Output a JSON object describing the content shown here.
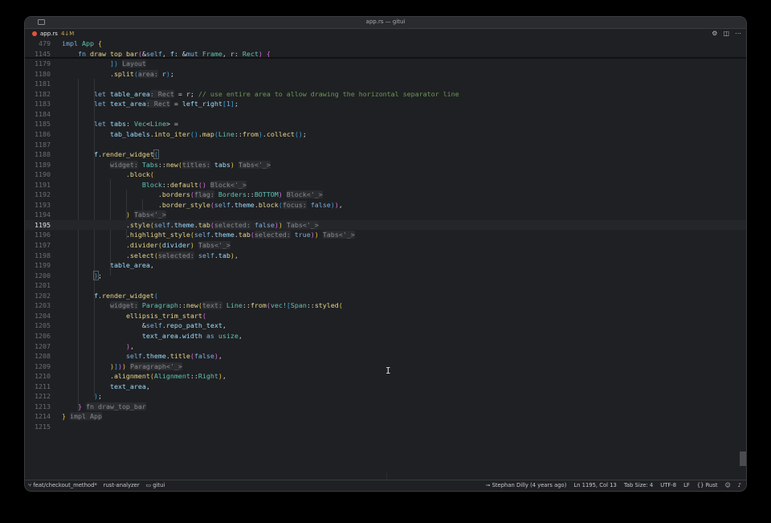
{
  "window_title": "app.rs — gitui",
  "tab": {
    "filename": "app.rs",
    "modified": "4↓M"
  },
  "code_lines": [
    {
      "n": "479",
      "html": "<span class=\"kw\">impl</span> <span class=\"ty\">App</span> <span class=\"br1\">{</span>"
    },
    {
      "n": "1145",
      "html": "    <span class=\"kw\">fn</span> <span class=\"fn\">draw_top_bar</span><span class=\"br2\">(</span>&amp;<span class=\"kw\">self</span>, <span class=\"var\">f</span>: &amp;<span class=\"kw\">mut</span> <span class=\"ty\">Frame</span>, <span class=\"var\">r</span>: <span class=\"ty\">Rect</span><span class=\"br2\">)</span> <span class=\"br2\">{</span>"
    },
    {
      "n": "1179",
      "html": "            <span class=\"br3\">]</span><span class=\"br3\">)</span> <span class=\"hint\">Layout</span>"
    },
    {
      "n": "1180",
      "html": "            .<span class=\"fn\">split</span><span class=\"br3\">(</span><span class=\"hint\">area:</span> <span class=\"var\">r</span><span class=\"br3\">)</span>;"
    },
    {
      "n": "1181",
      "html": ""
    },
    {
      "n": "1182",
      "html": "        <span class=\"kw\">let</span> <span class=\"var\">table_area</span><span class=\"hint\">: Rect</span> = <span class=\"var\">r</span>; <span class=\"cm\">// use entire area to allow drawing the horizontal separator line</span>"
    },
    {
      "n": "1183",
      "html": "        <span class=\"kw\">let</span> <span class=\"var\">text_area</span><span class=\"hint\">: Rect</span> = <span class=\"var\">left_right</span><span class=\"br3\">[</span><span class=\"lit\">1</span><span class=\"br3\">]</span>;"
    },
    {
      "n": "1184",
      "html": ""
    },
    {
      "n": "1185",
      "html": "        <span class=\"kw\">let</span> <span class=\"var\">tabs</span>: <span class=\"ty\">Vec</span>&lt;<span class=\"ty\">Line</span>&gt; ="
    },
    {
      "n": "1186",
      "html": "            <span class=\"var\">tab_labels</span>.<span class=\"fn\">into_iter</span><span class=\"br3\">()</span>.<span class=\"fn\">map</span><span class=\"br3\">(</span><span class=\"ty\">Line</span>::<span class=\"fn\">from</span><span class=\"br3\">)</span>.<span class=\"fn\">collect</span><span class=\"br3\">()</span>;"
    },
    {
      "n": "1187",
      "html": ""
    },
    {
      "n": "1188",
      "html": "        <span class=\"var\">f</span>.<span class=\"fn\">render_widget</span><span class=\"br3 bm\">(</span>"
    },
    {
      "n": "1189",
      "html": "            <span class=\"hint\">widget:</span> <span class=\"ty\">Tabs</span>::<span class=\"fn\">new</span><span class=\"br1\">(</span><span class=\"hint\">titles:</span> <span class=\"var\">tabs</span><span class=\"br1\">)</span> <span class=\"hint\">Tabs&lt;'_&gt;</span>"
    },
    {
      "n": "1190",
      "html": "                .<span class=\"fn\">block</span><span class=\"br1\">(</span>"
    },
    {
      "n": "1191",
      "html": "                    <span class=\"ty\">Block</span>::<span class=\"fn\">default</span><span class=\"br2\">()</span> <span class=\"hint\">Block&lt;'_&gt;</span>"
    },
    {
      "n": "1192",
      "html": "                        .<span class=\"fn\">borders</span><span class=\"br2\">(</span><span class=\"hint\">flag:</span> <span class=\"ty\">Borders</span>::<span class=\"ty\">BOTTOM</span><span class=\"br2\">)</span> <span class=\"hint\">Block&lt;'_&gt;</span>"
    },
    {
      "n": "1193",
      "html": "                        .<span class=\"fn\">border_style</span><span class=\"br2\">(</span><span class=\"kw\">self</span>.<span class=\"var\">theme</span>.<span class=\"fn\">block</span><span class=\"br3\">(</span><span class=\"hint\">focus:</span> <span class=\"lit\">false</span><span class=\"br3\">)</span><span class=\"br2\">)</span>,"
    },
    {
      "n": "1194",
      "html": "                <span class=\"br1\">)</span> <span class=\"hint\">Tabs&lt;'_&gt;</span>"
    },
    {
      "n": "1195",
      "html": "                .<span class=\"fn\">style</span><span class=\"br1\">(</span><span class=\"kw\">self</span>.<span class=\"var\">theme</span>.<span class=\"fn\">tab</span><span class=\"br2\">(</span><span class=\"hint\">selected:</span> <span class=\"lit\">false</span><span class=\"br2\">)</span><span class=\"br1\">)</span> <span class=\"hint\">Tabs&lt;'_&gt;</span>",
      "current": true
    },
    {
      "n": "1196",
      "html": "                .<span class=\"fn\">highlight_style</span><span class=\"br1\">(</span><span class=\"kw\">self</span>.<span class=\"var\">theme</span>.<span class=\"fn\">tab</span><span class=\"br2\">(</span><span class=\"hint\">selected:</span> <span class=\"lit\">true</span><span class=\"br2\">)</span><span class=\"br1\">)</span> <span class=\"hint\">Tabs&lt;'_&gt;</span>"
    },
    {
      "n": "1197",
      "html": "                .<span class=\"fn\">divider</span><span class=\"br1\">(</span><span class=\"var\">divider</span><span class=\"br1\">)</span> <span class=\"hint\">Tabs&lt;'_&gt;</span>"
    },
    {
      "n": "1198",
      "html": "                .<span class=\"fn\">select</span><span class=\"br1\">(</span><span class=\"hint\">selected:</span> <span class=\"kw\">self</span>.<span class=\"var\">tab</span><span class=\"br1\">)</span>,"
    },
    {
      "n": "1199",
      "html": "            <span class=\"var\">table_area</span>,"
    },
    {
      "n": "1200",
      "html": "        <span class=\"br3 bm\">)</span>;"
    },
    {
      "n": "1201",
      "html": ""
    },
    {
      "n": "1202",
      "html": "        <span class=\"var\">f</span>.<span class=\"fn\">render_widget</span><span class=\"br3\">(</span>"
    },
    {
      "n": "1203",
      "html": "            <span class=\"hint\">widget:</span> <span class=\"ty\">Paragraph</span>::<span class=\"fn\">new</span><span class=\"br1\">(</span><span class=\"hint\">text:</span> <span class=\"ty\">Line</span>::<span class=\"fn\">from</span><span class=\"br2\">(</span><span class=\"mac\">vec!</span><span class=\"br3\">[</span><span class=\"ty\">Span</span>::<span class=\"fn\">styled</span><span class=\"br1\">(</span>"
    },
    {
      "n": "1204",
      "html": "                <span class=\"fn\">ellipsis_trim_start</span><span class=\"br2\">(</span>"
    },
    {
      "n": "1205",
      "html": "                    &amp;<span class=\"kw\">self</span>.<span class=\"var\">repo_path_text</span>,"
    },
    {
      "n": "1206",
      "html": "                    <span class=\"var\">text_area</span>.<span class=\"var\">width</span> <span class=\"kw\">as</span> <span class=\"ty\">usize</span>,"
    },
    {
      "n": "1207",
      "html": "                <span class=\"br2\">)</span>,"
    },
    {
      "n": "1208",
      "html": "                <span class=\"kw\">self</span>.<span class=\"var\">theme</span>.<span class=\"fn\">title</span><span class=\"br2\">(</span><span class=\"lit\">false</span><span class=\"br2\">)</span>,"
    },
    {
      "n": "1209",
      "html": "            <span class=\"br1\">)</span><span class=\"br3\">]</span><span class=\"br2\">)</span><span class=\"br1\">)</span> <span class=\"hint\">Paragraph&lt;'_&gt;</span>"
    },
    {
      "n": "1210",
      "html": "            .<span class=\"fn\">alignment</span><span class=\"br1\">(</span><span class=\"ty\">Alignment</span>::<span class=\"ty\">Right</span><span class=\"br1\">)</span>,"
    },
    {
      "n": "1211",
      "html": "            <span class=\"var\">text_area</span>,"
    },
    {
      "n": "1212",
      "html": "        <span class=\"br3\">)</span>;"
    },
    {
      "n": "1213",
      "html": "    <span class=\"br2\">}</span> <span class=\"hint\">fn draw_top_bar</span>"
    },
    {
      "n": "1214",
      "html": "<span class=\"br1\">}</span> <span class=\"hint\">impl App</span>"
    },
    {
      "n": "1215",
      "html": ""
    }
  ],
  "status": {
    "branch": "feat/checkout_method*",
    "language_server": "rust-analyzer",
    "folder": "gitui",
    "blame": "Stephan Dilly (4 years ago)",
    "position": "Ln 1195, Col 13",
    "tab_size": "Tab Size: 4",
    "encoding": "UTF-8",
    "eol": "LF",
    "language": "Rust"
  },
  "colors": {
    "editor_bg": "#1f2023",
    "keyword": "#7ab0df",
    "type": "#5ec4b6",
    "function": "#e8d68a",
    "comment": "#6a9955",
    "tab_icon": "#e0553a"
  },
  "icons": [
    "sidebar-toggle-icon",
    "rust-file-icon",
    "settings-gear-icon",
    "split-editor-icon",
    "more-actions-icon",
    "branch-icon",
    "folder-icon",
    "git-commit-icon",
    "braces-icon",
    "copilot-icon",
    "bell-icon",
    "text-cursor-icon"
  ]
}
